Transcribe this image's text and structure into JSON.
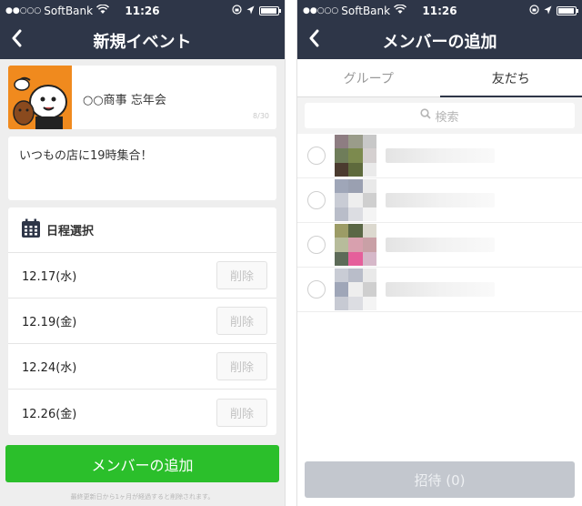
{
  "status_bar": {
    "signal": "●●○○○",
    "carrier": "SoftBank",
    "time": "11:26",
    "battery_level": 0.85
  },
  "left_screen": {
    "title": "新規イベント",
    "event": {
      "name": "○○商事 忘年会",
      "char_count": "8/30",
      "thumbnail_icon": "brown-bear-sticker-icon"
    },
    "memo": "いつもの店に19時集合！",
    "schedule": {
      "title": "日程選択",
      "dates": [
        {
          "date": "12.17(水)",
          "delete_label": "削除"
        },
        {
          "date": "12.19(金)",
          "delete_label": "削除"
        },
        {
          "date": "12.24(水)",
          "delete_label": "削除"
        },
        {
          "date": "12.26(金)",
          "delete_label": "削除"
        }
      ]
    },
    "add_member_button": "メンバーの追加",
    "footnote": "最終更新日から1ヶ月が経過すると削除されます。"
  },
  "right_screen": {
    "title": "メンバーの追加",
    "tabs": [
      {
        "label": "グループ",
        "active": false
      },
      {
        "label": "友だち",
        "active": true
      }
    ],
    "search_placeholder": "検索",
    "friends": [
      {
        "avatar_colors": [
          "#8e7d82",
          "#9a9c8a",
          "#c8c8c8",
          "#6f7d5a",
          "#7c8a4e",
          "#d5d0d0",
          "#4b3b2f",
          "#5e6a3c",
          "#eaeaea"
        ]
      },
      {
        "avatar_colors": [
          "#9fa6b8",
          "#9aa0b1",
          "#e9e9e9",
          "#c9ccd5",
          "#eeeeee",
          "#cfcfcf",
          "#b9bdc9",
          "#dcdde2",
          "#f4f4f4"
        ]
      },
      {
        "avatar_colors": [
          "#9c9c66",
          "#5a6745",
          "#dcd9cf",
          "#b7bc9b",
          "#d8a0ae",
          "#c9a0a6",
          "#5d6b58",
          "#e55f9b",
          "#d6b8c9"
        ]
      },
      {
        "avatar_colors": [
          "#c9ccd5",
          "#b9bdc9",
          "#e9e9e9",
          "#9fa6b8",
          "#eeeeee",
          "#cfcfcf",
          "#c7cad3",
          "#dcdde2",
          "#f4f4f4"
        ]
      }
    ],
    "invite_button": "招待 (0)"
  },
  "colors": {
    "nav_bg": "#2e3648",
    "green_button": "#2bbf2b",
    "disabled_button": "#c3c7ce",
    "event_thumb": "#f08a1e"
  }
}
